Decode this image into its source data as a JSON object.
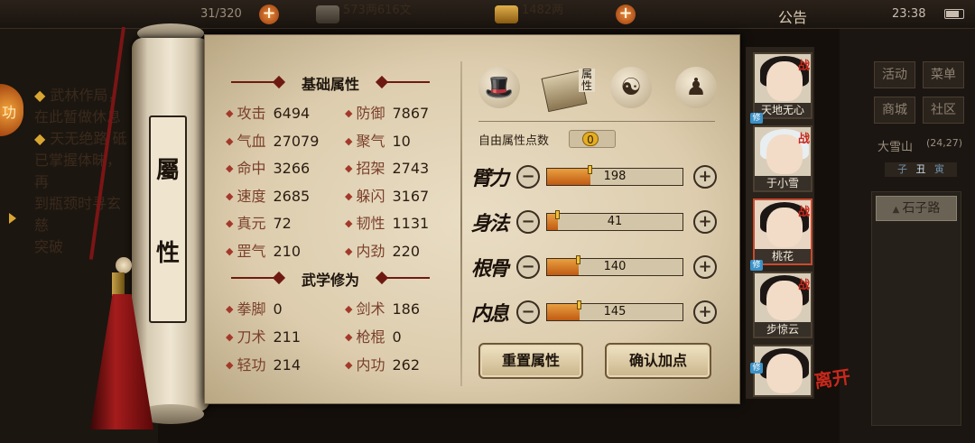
{
  "topbar": {
    "food_value": "31/320",
    "money_value": "573两616文",
    "gold_value": "1482两",
    "notice_label": "公告",
    "time": "23:38"
  },
  "left_panel": {
    "side_tab_glyph": "功",
    "lines": [
      {
        "text": "武林作局，",
        "bullet": true
      },
      {
        "text": "在此暂做休息",
        "bullet": false
      },
      {
        "text": "天无绝路 砥",
        "bullet": true
      },
      {
        "text": "已掌握体昧，再",
        "bullet": false
      },
      {
        "text": "到瓶颈时寻玄慈",
        "bullet": false
      },
      {
        "text": "突破",
        "bullet": false
      }
    ]
  },
  "scroll": {
    "label_top": "屬",
    "label_bottom": "性"
  },
  "basic_attributes": {
    "title": "基础属性",
    "left": [
      {
        "label": "攻击",
        "value": "6494"
      },
      {
        "label": "气血",
        "value": "27079"
      },
      {
        "label": "命中",
        "value": "3266"
      },
      {
        "label": "速度",
        "value": "2685"
      },
      {
        "label": "真元",
        "value": "72"
      },
      {
        "label": "罡气",
        "value": "210"
      }
    ],
    "right": [
      {
        "label": "防御",
        "value": "7867"
      },
      {
        "label": "聚气",
        "value": "10"
      },
      {
        "label": "招架",
        "value": "2743"
      },
      {
        "label": "躲闪",
        "value": "3167"
      },
      {
        "label": "韧性",
        "value": "1131"
      },
      {
        "label": "内劲",
        "value": "220"
      }
    ]
  },
  "martial_cultivation": {
    "title": "武学修为",
    "left": [
      {
        "label": "拳脚",
        "value": "0"
      },
      {
        "label": "刀术",
        "value": "211"
      },
      {
        "label": "轻功",
        "value": "214"
      }
    ],
    "right": [
      {
        "label": "剑术",
        "value": "186"
      },
      {
        "label": "枪棍",
        "value": "0"
      },
      {
        "label": "内功",
        "value": "262"
      }
    ]
  },
  "tabs": {
    "active_label": "属性",
    "icons": [
      "hat-icon",
      "attribute-book-icon",
      "yinyang-icon",
      "meridian-figure-icon"
    ]
  },
  "free_points": {
    "label": "自由属性点数",
    "value": "0"
  },
  "allocations": [
    {
      "label": "臂力",
      "value": "198",
      "fraction": 0.32
    },
    {
      "label": "身法",
      "value": "41",
      "fraction": 0.08
    },
    {
      "label": "根骨",
      "value": "140",
      "fraction": 0.23
    },
    {
      "label": "内息",
      "value": "145",
      "fraction": 0.24
    }
  ],
  "buttons": {
    "reset": "重置属性",
    "confirm": "确认加点"
  },
  "right_menu": {
    "buttons": [
      "活动",
      "菜单",
      "商城",
      "社区"
    ],
    "location": "大雪山",
    "coords": "(24,27)",
    "time_marks": [
      "子",
      "丑",
      "寅"
    ],
    "road_label": "石子路"
  },
  "characters": [
    {
      "name": "天地无心",
      "battle": "战",
      "tag": "修"
    },
    {
      "name": "于小雪",
      "battle": "战",
      "tag": ""
    },
    {
      "name": "桃花",
      "battle": "战",
      "tag": "修"
    },
    {
      "name": "步惊云",
      "battle": "战",
      "tag": ""
    },
    {
      "name": "",
      "battle": "",
      "tag": "修"
    }
  ],
  "leave_label": "离开"
}
